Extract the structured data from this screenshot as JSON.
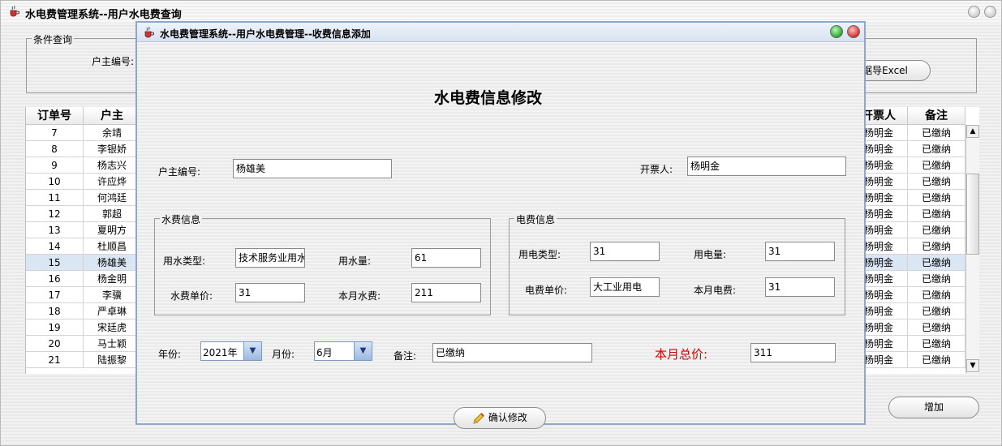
{
  "main": {
    "title": "水电费管理系统--用户水电费查询",
    "filter_group": "条件查询",
    "owner_id_label": "户主编号:",
    "export_label": "据导Excel",
    "add_label": "增加",
    "table": {
      "headers": [
        "订单号",
        "户主",
        "开票人",
        "备注"
      ],
      "rows": [
        {
          "id": "7",
          "owner": "余靖",
          "issuer": "杨明金",
          "note": "已缴纳"
        },
        {
          "id": "8",
          "owner": "李银娇",
          "issuer": "杨明金",
          "note": "已缴纳"
        },
        {
          "id": "9",
          "owner": "杨志兴",
          "issuer": "杨明金",
          "note": "已缴纳"
        },
        {
          "id": "10",
          "owner": "许应烨",
          "issuer": "杨明金",
          "note": "已缴纳"
        },
        {
          "id": "11",
          "owner": "何鸿廷",
          "issuer": "杨明金",
          "note": "已缴纳"
        },
        {
          "id": "12",
          "owner": "郭超",
          "issuer": "杨明金",
          "note": "已缴纳"
        },
        {
          "id": "13",
          "owner": "夏明方",
          "issuer": "杨明金",
          "note": "已缴纳"
        },
        {
          "id": "14",
          "owner": "杜顺昌",
          "issuer": "杨明金",
          "note": "已缴纳"
        },
        {
          "id": "15",
          "owner": "杨雄美",
          "issuer": "杨明金",
          "note": "已缴纳"
        },
        {
          "id": "16",
          "owner": "杨金明",
          "issuer": "杨明金",
          "note": "已缴纳"
        },
        {
          "id": "17",
          "owner": "李骥",
          "issuer": "杨明金",
          "note": "已缴纳"
        },
        {
          "id": "18",
          "owner": "严卓琳",
          "issuer": "杨明金",
          "note": "已缴纳"
        },
        {
          "id": "19",
          "owner": "宋廷虎",
          "issuer": "杨明金",
          "note": "已缴纳"
        },
        {
          "id": "20",
          "owner": "马士颖",
          "issuer": "杨明金",
          "note": "已缴纳"
        },
        {
          "id": "21",
          "owner": "陆振黎",
          "issuer": "杨明金",
          "note": "已缴纳"
        }
      ],
      "selected_row": 8
    }
  },
  "dialog": {
    "title": "水电费管理系统--用户水电费管理--收费信息添加",
    "heading": "水电费信息修改",
    "owner_id_label": "户主编号:",
    "owner_id_value": "杨雄美",
    "issuer_label": "开票人:",
    "issuer_value": "杨明金",
    "water_group": "水费信息",
    "water_type_label": "用水类型:",
    "water_type_value": "技术服务业用水",
    "water_usage_label": "用水量:",
    "water_usage_value": "61",
    "water_price_label": "水费单价:",
    "water_price_value": "31",
    "water_fee_label": "本月水费:",
    "water_fee_value": "211",
    "elec_group": "电费信息",
    "elec_type_label": "用电类型:",
    "elec_type_value": "31",
    "elec_usage_label": "用电量:",
    "elec_usage_value": "31",
    "elec_price_label": "电费单价:",
    "elec_price_value": "大工业用电",
    "elec_fee_label": "本月电费:",
    "elec_fee_value": "31",
    "year_label": "年份:",
    "year_value": "2021年",
    "month_label": "月份:",
    "month_value": "6月",
    "note_label": "备注:",
    "note_value": "已缴纳",
    "total_label": "本月总价:",
    "total_value": "311",
    "confirm_label": "确认修改"
  },
  "colors": {
    "dialog_border": "#8da8cc",
    "selected_row": "#dbe6f4",
    "total_label": "#d40000",
    "combo_arrow": "#9cb8de"
  }
}
